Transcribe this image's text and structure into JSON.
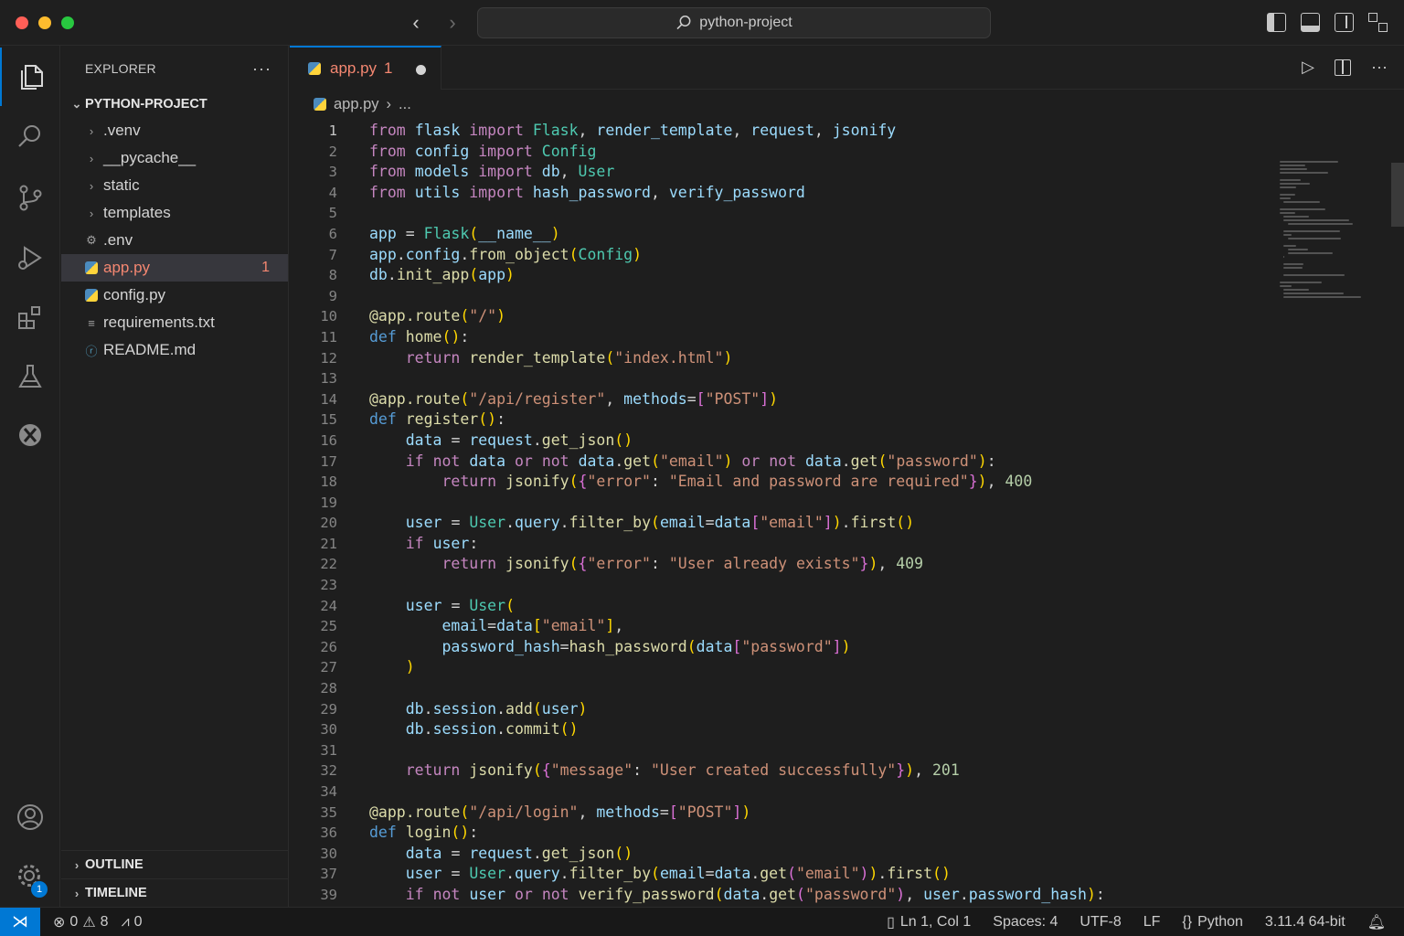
{
  "window": {
    "search_text": "python-project"
  },
  "activity_bar": {
    "settings_badge": "1"
  },
  "sidebar": {
    "title": "EXPLORER",
    "more": "···",
    "project": "PYTHON-PROJECT",
    "items": [
      {
        "label": ".venv",
        "kind": "folder"
      },
      {
        "label": "__pycache__",
        "kind": "folder"
      },
      {
        "label": "static",
        "kind": "folder"
      },
      {
        "label": "templates",
        "kind": "folder"
      },
      {
        "label": ".env",
        "kind": "env"
      },
      {
        "label": "app.py",
        "kind": "python",
        "problems": "1"
      },
      {
        "label": "config.py",
        "kind": "python"
      },
      {
        "label": "requirements.txt",
        "kind": "text"
      },
      {
        "label": "README.md",
        "kind": "info"
      }
    ],
    "outline": "OUTLINE",
    "timeline": "TIMELINE"
  },
  "editor": {
    "tab": {
      "label": "app.py",
      "problems": "1"
    },
    "breadcrumb": {
      "file": "app.py",
      "rest": "..."
    },
    "line_numbers": [
      "1",
      "2",
      "3",
      "4",
      "5",
      "6",
      "7",
      "8",
      "9",
      "10",
      "11",
      "12",
      "13",
      "14",
      "15",
      "16",
      "17",
      "18",
      "19",
      "20",
      "21",
      "22",
      "23",
      "24",
      "25",
      "26",
      "27",
      "28",
      "29",
      "30",
      "31",
      "32",
      "34",
      "35",
      "36",
      "30",
      "37",
      "39"
    ],
    "code": [
      "from flask import Flask, render_template, request, jsonify",
      "from config import Config",
      "from models import db, User",
      "from utils import hash_password, verify_password",
      "",
      "app = Flask(__name__)",
      "app.config.from_object(Config)",
      "db.init_app(app)",
      "",
      "@app.route(\"/\")",
      "def home():",
      "    return render_template(\"index.html\")",
      "",
      "@app.route(\"/api/register\", methods=[\"POST\"])",
      "def register():",
      "    data = request.get_json()",
      "    if not data or not data.get(\"email\") or not data.get(\"password\"):",
      "        return jsonify({\"error\": \"Email and password are required\"}), 400",
      "",
      "    user = User.query.filter_by(email=data[\"email\"]).first()",
      "    if user:",
      "        return jsonify({\"error\": \"User already exists\"}), 409",
      "",
      "    user = User(",
      "        email=data[\"email\"],",
      "        password_hash=hash_password(data[\"password\"])",
      "    )",
      "",
      "    db.session.add(user)",
      "    db.session.commit()",
      "",
      "    return jsonify({\"message\": \"User created successfully\"}), 201",
      "",
      "@app.route(\"/api/login\", methods=[\"POST\"])",
      "def login():",
      "    data = request.get_json()",
      "    user = User.query.filter_by(email=data.get(\"email\")).first()",
      "    if not user or not verify_password(data.get(\"password\"), user.password_hash):"
    ]
  },
  "statusbar": {
    "errors": "0",
    "warnings": "8",
    "ports": "0",
    "position": "Ln 1, Col 1",
    "spaces": "Spaces: 4",
    "encoding": "UTF-8",
    "eol": "LF",
    "language": "Python",
    "interpreter": "3.11.4 64-bit"
  },
  "colors": {
    "accent": "#0078d4",
    "error": "#f48771"
  }
}
